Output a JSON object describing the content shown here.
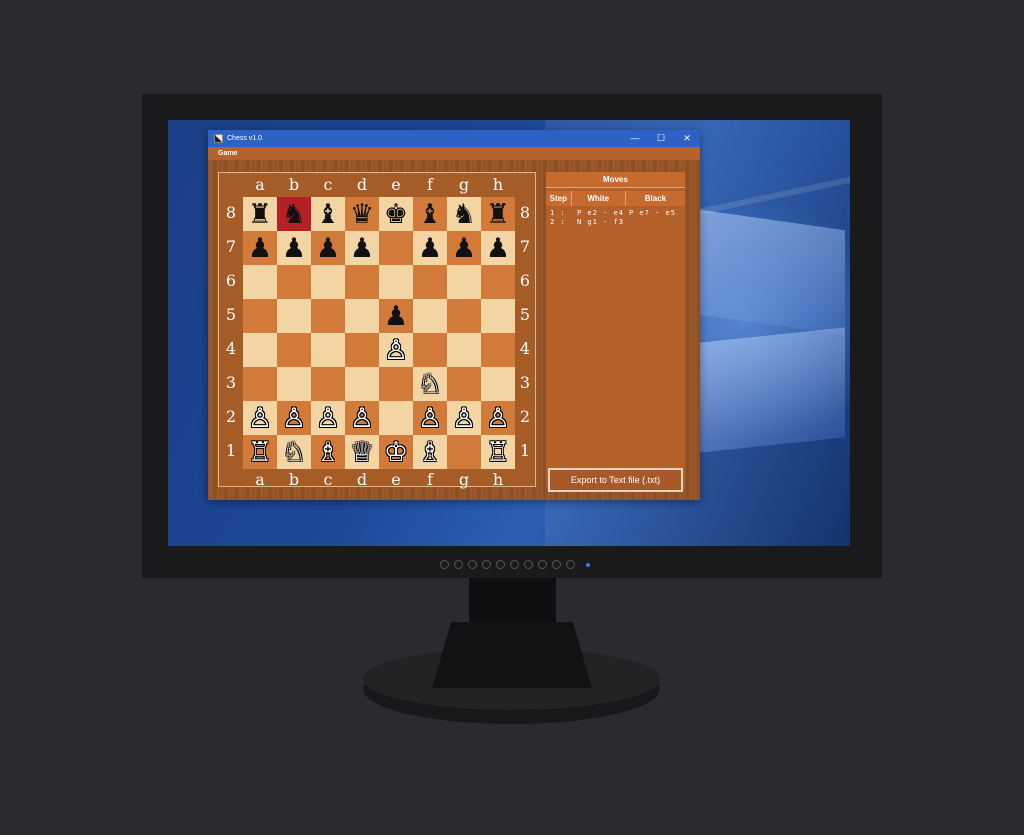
{
  "window": {
    "title": "Chess v1.0",
    "minimize": "—",
    "maximize": "☐",
    "close": "✕"
  },
  "menu": {
    "game": "Game"
  },
  "board": {
    "files": [
      "a",
      "b",
      "c",
      "d",
      "e",
      "f",
      "g",
      "h"
    ],
    "ranks": [
      "8",
      "7",
      "6",
      "5",
      "4",
      "3",
      "2",
      "1"
    ],
    "highlighted_square": "b8",
    "position": {
      "a8": "♜",
      "b8": "♞",
      "c8": "♝",
      "d8": "♛",
      "e8": "♚",
      "f8": "♝",
      "g8": "♞",
      "h8": "♜",
      "a7": "♟",
      "b7": "♟",
      "c7": "♟",
      "d7": "♟",
      "f7": "♟",
      "g7": "♟",
      "h7": "♟",
      "e5": "♟",
      "e4": "♙",
      "f3": "♘",
      "a2": "♙",
      "b2": "♙",
      "c2": "♙",
      "d2": "♙",
      "f2": "♙",
      "g2": "♙",
      "h2": "♙",
      "a1": "♖",
      "b1": "♘",
      "c1": "♗",
      "d1": "♕",
      "e1": "♔",
      "f1": "♗",
      "h1": "♖"
    }
  },
  "moves": {
    "title": "Moves",
    "columns": {
      "step": "Step",
      "white": "White",
      "black": "Black"
    },
    "rows": [
      {
        "step": "1 :",
        "white": "P e2 - e4",
        "black": "P e7 - e5"
      },
      {
        "step": "2 :",
        "white": "N g1 - f3",
        "black": ""
      }
    ],
    "export_label": "Export to Text file (.txt)"
  },
  "colors": {
    "light_square": "#f3d5a4",
    "dark_square": "#d17a3a",
    "highlight": "#b32025",
    "titlebar": "#2c62c6"
  }
}
